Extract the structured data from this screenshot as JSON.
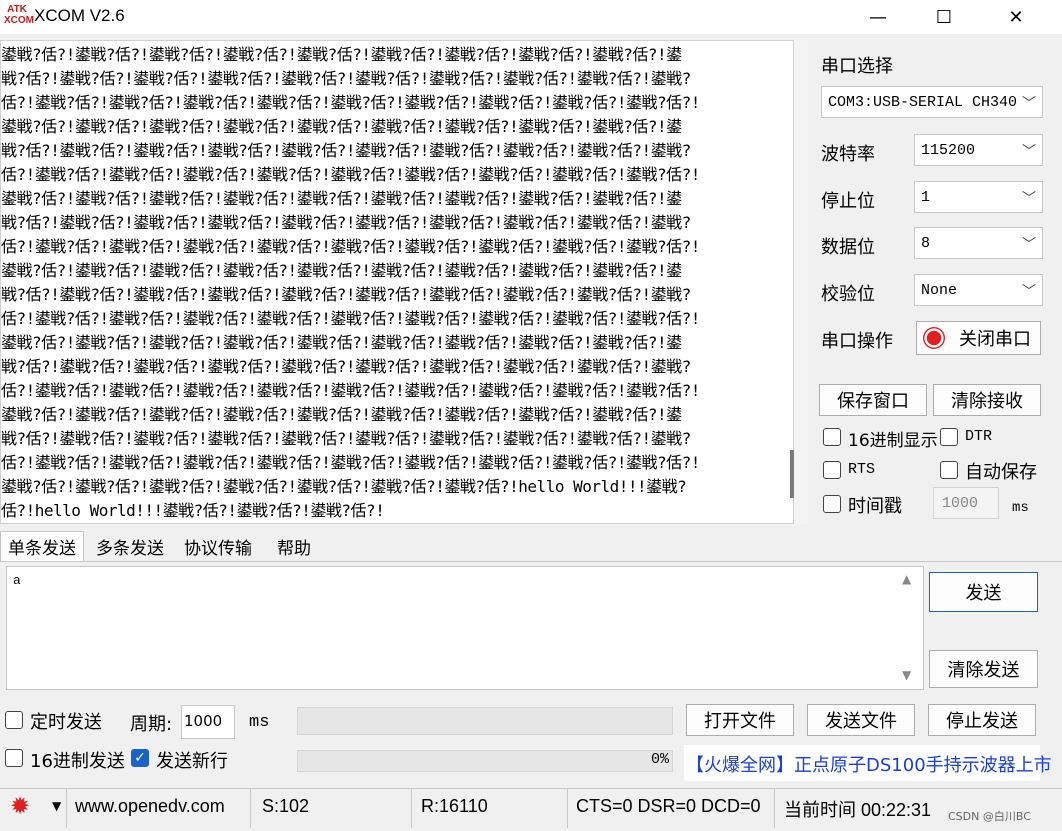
{
  "window": {
    "logo_text": "ATK XCOM",
    "title": "XCOM V2.6",
    "minimize": "—",
    "maximize": "☐",
    "close": "✕"
  },
  "receive": {
    "lines": [
      "鍙戦?佸?!鍙戦?佸?!鍙戦?佸?!鍙戦?佸?!鍙戦?佸?!鍙戦?佸?!鍙戦?佸?!鍙戦?佸?!鍙戦?佸?!鍙",
      "戦?佸?!鍙戦?佸?!鍙戦?佸?!鍙戦?佸?!鍙戦?佸?!鍙戦?佸?!鍙戦?佸?!鍙戦?佸?!鍙戦?佸?!鍙戦?",
      "佸?!鍙戦?佸?!鍙戦?佸?!鍙戦?佸?!鍙戦?佸?!鍙戦?佸?!鍙戦?佸?!鍙戦?佸?!鍙戦?佸?!鍙戦?佸?!",
      "鍙戦?佸?!鍙戦?佸?!鍙戦?佸?!鍙戦?佸?!鍙戦?佸?!鍙戦?佸?!鍙戦?佸?!鍙戦?佸?!鍙戦?佸?!鍙",
      "戦?佸?!鍙戦?佸?!鍙戦?佸?!鍙戦?佸?!鍙戦?佸?!鍙戦?佸?!鍙戦?佸?!鍙戦?佸?!鍙戦?佸?!鍙戦?",
      "佸?!鍙戦?佸?!鍙戦?佸?!鍙戦?佸?!鍙戦?佸?!鍙戦?佸?!鍙戦?佸?!鍙戦?佸?!鍙戦?佸?!鍙戦?佸?!",
      "鍙戦?佸?!鍙戦?佸?!鍙戦?佸?!鍙戦?佸?!鍙戦?佸?!鍙戦?佸?!鍙戦?佸?!鍙戦?佸?!鍙戦?佸?!鍙",
      "戦?佸?!鍙戦?佸?!鍙戦?佸?!鍙戦?佸?!鍙戦?佸?!鍙戦?佸?!鍙戦?佸?!鍙戦?佸?!鍙戦?佸?!鍙戦?",
      "佸?!鍙戦?佸?!鍙戦?佸?!鍙戦?佸?!鍙戦?佸?!鍙戦?佸?!鍙戦?佸?!鍙戦?佸?!鍙戦?佸?!鍙戦?佸?!",
      "鍙戦?佸?!鍙戦?佸?!鍙戦?佸?!鍙戦?佸?!鍙戦?佸?!鍙戦?佸?!鍙戦?佸?!鍙戦?佸?!鍙戦?佸?!鍙",
      "戦?佸?!鍙戦?佸?!鍙戦?佸?!鍙戦?佸?!鍙戦?佸?!鍙戦?佸?!鍙戦?佸?!鍙戦?佸?!鍙戦?佸?!鍙戦?",
      "佸?!鍙戦?佸?!鍙戦?佸?!鍙戦?佸?!鍙戦?佸?!鍙戦?佸?!鍙戦?佸?!鍙戦?佸?!鍙戦?佸?!鍙戦?佸?!",
      "鍙戦?佸?!鍙戦?佸?!鍙戦?佸?!鍙戦?佸?!鍙戦?佸?!鍙戦?佸?!鍙戦?佸?!鍙戦?佸?!鍙戦?佸?!鍙",
      "戦?佸?!鍙戦?佸?!鍙戦?佸?!鍙戦?佸?!鍙戦?佸?!鍙戦?佸?!鍙戦?佸?!鍙戦?佸?!鍙戦?佸?!鍙戦?",
      "佸?!鍙戦?佸?!鍙戦?佸?!鍙戦?佸?!鍙戦?佸?!鍙戦?佸?!鍙戦?佸?!鍙戦?佸?!鍙戦?佸?!鍙戦?佸?!",
      "鍙戦?佸?!鍙戦?佸?!鍙戦?佸?!鍙戦?佸?!鍙戦?佸?!鍙戦?佸?!鍙戦?佸?!鍙戦?佸?!鍙戦?佸?!鍙",
      "戦?佸?!鍙戦?佸?!鍙戦?佸?!鍙戦?佸?!鍙戦?佸?!鍙戦?佸?!鍙戦?佸?!鍙戦?佸?!鍙戦?佸?!鍙戦?",
      "佸?!鍙戦?佸?!鍙戦?佸?!鍙戦?佸?!鍙戦?佸?!鍙戦?佸?!鍙戦?佸?!鍙戦?佸?!鍙戦?佸?!鍙戦?佸?!",
      "鍙戦?佸?!鍙戦?佸?!鍙戦?佸?!鍙戦?佸?!鍙戦?佸?!鍙戦?佸?!鍙戦?佸?!hello World!!!鍙戦?",
      "佸?!hello World!!!鍙戦?佸?!鍙戦?佸?!鍙戦?佸?!"
    ]
  },
  "serial": {
    "port_label": "串口选择",
    "port_value": "COM3:USB-SERIAL CH340",
    "baud_label": "波特率",
    "baud_value": "115200",
    "stop_label": "停止位",
    "stop_value": "1",
    "data_label": "数据位",
    "data_value": "8",
    "parity_label": "校验位",
    "parity_value": "None",
    "op_label": "串口操作",
    "close_port": "关闭串口",
    "save_window": "保存窗口",
    "clear_recv": "清除接收",
    "hex_display": "16进制显示",
    "dtr": "DTR",
    "rts": "RTS",
    "auto_save": "自动保存",
    "timestamp": "时间戳",
    "timestamp_value": "1000",
    "ms": "ms"
  },
  "tabs": [
    "单条发送",
    "多条发送",
    "协议传输",
    "帮助"
  ],
  "send": {
    "text": "a",
    "send_button": "发送",
    "clear_send": "清除发送",
    "timed_send": "定时发送",
    "period_label": "周期:",
    "period_value": "1000",
    "ms": "ms",
    "open_file": "打开文件",
    "send_file": "发送文件",
    "stop_send": "停止发送",
    "hex_send": "16进制发送",
    "send_newline": "发送新行",
    "progress": "0%",
    "ad_text": "【火爆全网】正点原子DS100手持示波器上市"
  },
  "status": {
    "url": "www.openedv.com",
    "sent": "S:102",
    "received": "R:16110",
    "lines": "CTS=0 DSR=0 DCD=0",
    "time": "当前时间 00:22:31",
    "watermark": "CSDN @白川BC"
  },
  "colors": {
    "accent": "#1a63c6",
    "ad_text": "#1a3fd6",
    "record": "#e02020"
  }
}
